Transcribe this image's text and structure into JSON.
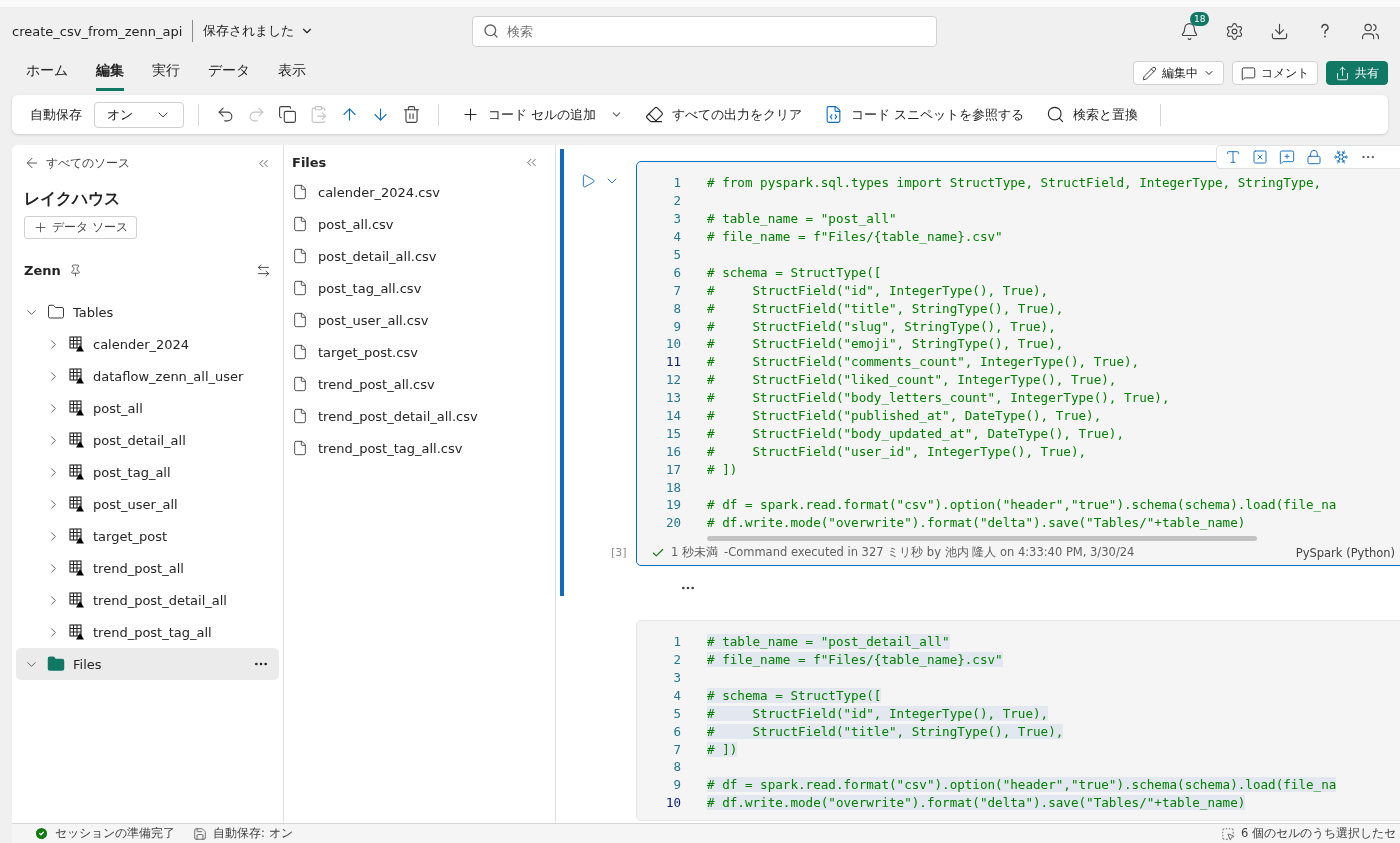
{
  "header": {
    "notebook_name": "create_csv_from_zenn_api",
    "save_status": "保存されました",
    "search": {
      "placeholder": "検索"
    },
    "notification_count": "18"
  },
  "ribbon": {
    "tabs": [
      {
        "label": "ホーム",
        "selected": false
      },
      {
        "label": "編集",
        "selected": true
      },
      {
        "label": "実行",
        "selected": false
      },
      {
        "label": "データ",
        "selected": false
      },
      {
        "label": "表示",
        "selected": false
      }
    ],
    "actions": [
      {
        "kind": "mode",
        "label": "編集中"
      },
      {
        "kind": "comment",
        "label": "コメント"
      },
      {
        "kind": "share",
        "label": "共有"
      }
    ]
  },
  "toolbar": {
    "autosave_label": "自動保存",
    "autosave_value": "オン",
    "icon_buttons": [
      {
        "kind": "undo",
        "disabled": false
      },
      {
        "kind": "redo",
        "disabled": true
      },
      {
        "kind": "copy",
        "disabled": false
      },
      {
        "kind": "paste",
        "disabled": true
      },
      {
        "kind": "up",
        "disabled": false
      },
      {
        "kind": "down",
        "disabled": false
      },
      {
        "kind": "delete",
        "disabled": false
      }
    ],
    "commands": [
      {
        "kind": "add",
        "label": "コード セルの追加"
      },
      {
        "kind": "clear",
        "label": "すべての出力をクリア"
      },
      {
        "kind": "snippet",
        "label": "コード スニペットを参照する"
      },
      {
        "kind": "find",
        "label": "検索と置換"
      }
    ]
  },
  "explorer": {
    "back": "すべてのソース",
    "title": "レイクハウス",
    "add_button": "データ ソース",
    "lakehouse": "Zenn",
    "tree": [
      {
        "label": "Tables",
        "kind": "folder",
        "expanded": true,
        "selected": false,
        "children": [
          {
            "label": "calender_2024",
            "kind": "table",
            "expanded": false,
            "selected": false
          },
          {
            "label": "dataflow_zenn_all_user",
            "kind": "table",
            "expanded": false,
            "selected": false
          },
          {
            "label": "post_all",
            "kind": "table",
            "expanded": false,
            "selected": false
          },
          {
            "label": "post_detail_all",
            "kind": "table",
            "expanded": false,
            "selected": false
          },
          {
            "label": "post_tag_all",
            "kind": "table",
            "expanded": false,
            "selected": false
          },
          {
            "label": "post_user_all",
            "kind": "table",
            "expanded": false,
            "selected": false
          },
          {
            "label": "target_post",
            "kind": "table",
            "expanded": false,
            "selected": false
          },
          {
            "label": "trend_post_all",
            "kind": "table",
            "expanded": false,
            "selected": false
          },
          {
            "label": "trend_post_detail_all",
            "kind": "table",
            "expanded": false,
            "selected": false
          },
          {
            "label": "trend_post_tag_all",
            "kind": "table",
            "expanded": false,
            "selected": false
          }
        ]
      },
      {
        "label": "Files",
        "kind": "files",
        "expanded": true,
        "selected": true
      }
    ]
  },
  "files_panel": {
    "title": "Files",
    "files": [
      "calender_2024.csv",
      "post_all.csv",
      "post_detail_all.csv",
      "post_tag_all.csv",
      "post_user_all.csv",
      "target_post.csv",
      "trend_post_all.csv",
      "trend_post_detail_all.csv",
      "trend_post_tag_all.csv"
    ]
  },
  "cells": [
    {
      "active": true,
      "text_selected": false,
      "execution_count": "[3]",
      "duration": "1 秒未満",
      "run_info": "-Command executed in 327 ミリ秒 by 池内 隆人 on 4:33:40 PM, 3/30/24",
      "language": "PySpark (Python)",
      "lines": [
        {
          "number": "1",
          "code": "# from pyspark.sql.types import StructType, StructField, IntegerType, StringType,",
          "current": false
        },
        {
          "number": "2",
          "current": false
        },
        {
          "number": "3",
          "code": "# table_name = \"post_all\"",
          "current": false
        },
        {
          "number": "4",
          "code": "# file_name = f\"Files/{table_name}.csv\"",
          "current": false
        },
        {
          "number": "5",
          "current": false
        },
        {
          "number": "6",
          "code": "# schema = StructType([",
          "current": false
        },
        {
          "number": "7",
          "code": "#     StructField(\"id\", IntegerType(), True),",
          "current": false
        },
        {
          "number": "8",
          "code": "#     StructField(\"title\", StringType(), True),",
          "current": false
        },
        {
          "number": "9",
          "code": "#     StructField(\"slug\", StringType(), True),",
          "current": false
        },
        {
          "number": "10",
          "code": "#     StructField(\"emoji\", StringType(), True),",
          "current": false
        },
        {
          "number": "11",
          "code": "#     StructField(\"comments_count\", IntegerType(), True),",
          "current": true
        },
        {
          "number": "12",
          "code": "#     StructField(\"liked_count\", IntegerType(), True),",
          "current": false
        },
        {
          "number": "13",
          "code": "#     StructField(\"body_letters_count\", IntegerType(), True),",
          "current": false
        },
        {
          "number": "14",
          "code": "#     StructField(\"published_at\", DateType(), True),",
          "current": false
        },
        {
          "number": "15",
          "code": "#     StructField(\"body_updated_at\", DateType(), True),",
          "current": false
        },
        {
          "number": "16",
          "code": "#     StructField(\"user_id\", IntegerType(), True),",
          "current": false
        },
        {
          "number": "17",
          "code": "# ])",
          "current": false
        },
        {
          "number": "18",
          "current": false
        },
        {
          "number": "19",
          "code": "# df = spark.read.format(\"csv\").option(\"header\",\"true\").schema(schema).load(file_na",
          "current": false
        },
        {
          "number": "20",
          "code": "# df.write.mode(\"overwrite\").format(\"delta\").save(\"Tables/\"+table_name)",
          "current": false
        }
      ]
    },
    {
      "active": false,
      "text_selected": true,
      "lines": [
        {
          "number": "1",
          "code": "# table_name = \"post_detail_all\"",
          "current": false
        },
        {
          "number": "2",
          "code": "# file_name = f\"Files/{table_name}.csv\"",
          "current": false
        },
        {
          "number": "3",
          "current": false
        },
        {
          "number": "4",
          "code": "# schema = StructType([",
          "current": false
        },
        {
          "number": "5",
          "code": "#     StructField(\"id\", IntegerType(), True),",
          "current": false
        },
        {
          "number": "6",
          "code": "#     StructField(\"title\", StringType(), True),",
          "current": false
        },
        {
          "number": "7",
          "code": "# ])",
          "current": false
        },
        {
          "number": "8",
          "current": false
        },
        {
          "number": "9",
          "code": "# df = spark.read.format(\"csv\").option(\"header\",\"true\").schema(schema).load(file_na",
          "current": false
        },
        {
          "number": "10",
          "code": "# df.write.mode(\"overwrite\").format(\"delta\").save(\"Tables/\"+table_name)",
          "current": true
        }
      ]
    }
  ],
  "status_bar": {
    "session": "セッションの準備完了",
    "autosave": "自動保存: オン",
    "selection": "6 個のセルのうち選択したセ"
  }
}
